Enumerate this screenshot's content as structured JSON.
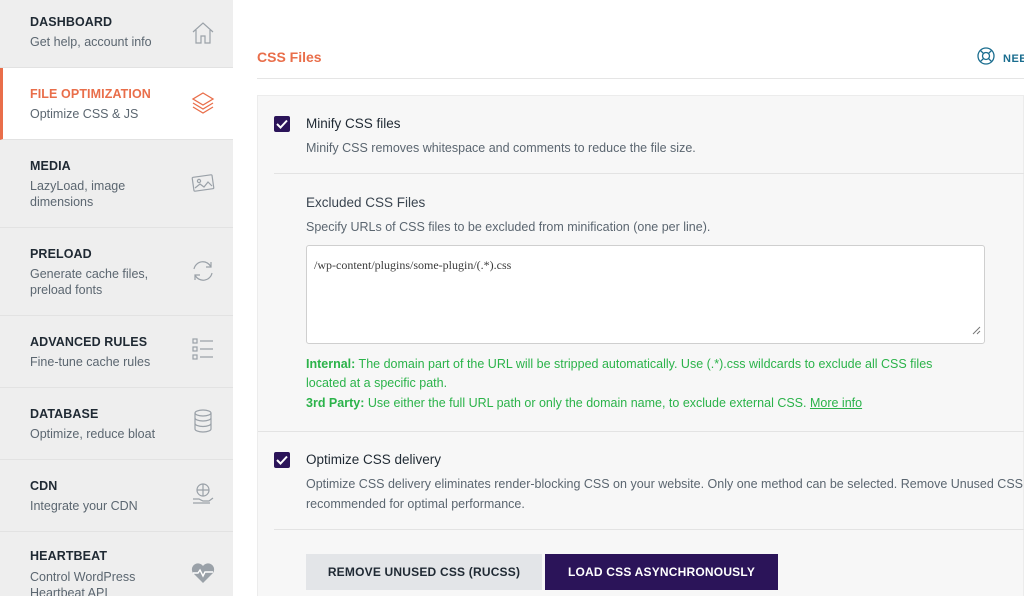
{
  "sidebar": {
    "items": [
      {
        "title": "DASHBOARD",
        "desc_lines": [
          "Get help, account info"
        ],
        "icon": "home-icon",
        "active": false
      },
      {
        "title": "FILE OPTIMIZATION",
        "desc_lines": [
          "Optimize CSS & JS"
        ],
        "icon": "layers-icon",
        "active": true
      },
      {
        "title": "MEDIA",
        "desc_lines": [
          "LazyLoad, image",
          "dimensions"
        ],
        "icon": "image-icon",
        "active": false
      },
      {
        "title": "PRELOAD",
        "desc_lines": [
          "Generate cache files,",
          "preload fonts"
        ],
        "icon": "refresh-icon",
        "active": false
      },
      {
        "title": "ADVANCED RULES",
        "desc_lines": [
          "Fine-tune cache rules"
        ],
        "icon": "checklist-icon",
        "active": false
      },
      {
        "title": "DATABASE",
        "desc_lines": [
          "Optimize, reduce bloat"
        ],
        "icon": "database-icon",
        "active": false
      },
      {
        "title": "CDN",
        "desc_lines": [
          "Integrate your CDN"
        ],
        "icon": "globe-hand-icon",
        "active": false
      },
      {
        "title": "HEARTBEAT",
        "desc_lines": [
          "Control WordPress",
          "Heartbeat API"
        ],
        "icon": "heart-pulse-icon",
        "active": false
      }
    ]
  },
  "main": {
    "section_title": "CSS Files",
    "help_label": "NEE",
    "minify": {
      "checked": true,
      "label": "Minify CSS files",
      "desc": "Minify CSS removes whitespace and comments to reduce the file size."
    },
    "excluded": {
      "label": "Excluded CSS Files",
      "desc": "Specify URLs of CSS files to be excluded from minification (one per line).",
      "value": "/wp-content/plugins/some-plugin/(.*).css"
    },
    "hints": {
      "internal_label": "Internal:",
      "internal_line1": " The domain part of the URL will be stripped automatically. Use (.*).css wildcards to exclude all CSS files",
      "internal_line2": "located at a specific path.",
      "third_label": "3rd Party:",
      "third_text": " Use either the full URL path or only the domain name, to exclude external CSS. ",
      "more_info": "More info"
    },
    "delivery": {
      "checked": true,
      "label": "Optimize CSS delivery",
      "desc_line1": "Optimize CSS delivery eliminates render-blocking CSS on your website. Only one method can be selected. Remove Unused CSS",
      "desc_line2": "recommended for optimal performance."
    },
    "buttons": {
      "rucss": "REMOVE UNUSED CSS (RUCSS)",
      "async": "LOAD CSS ASYNCHRONOUSLY"
    }
  },
  "colors": {
    "accent": "#e96e4a",
    "purple": "#2b1459",
    "hint_green": "#2bb34a"
  }
}
